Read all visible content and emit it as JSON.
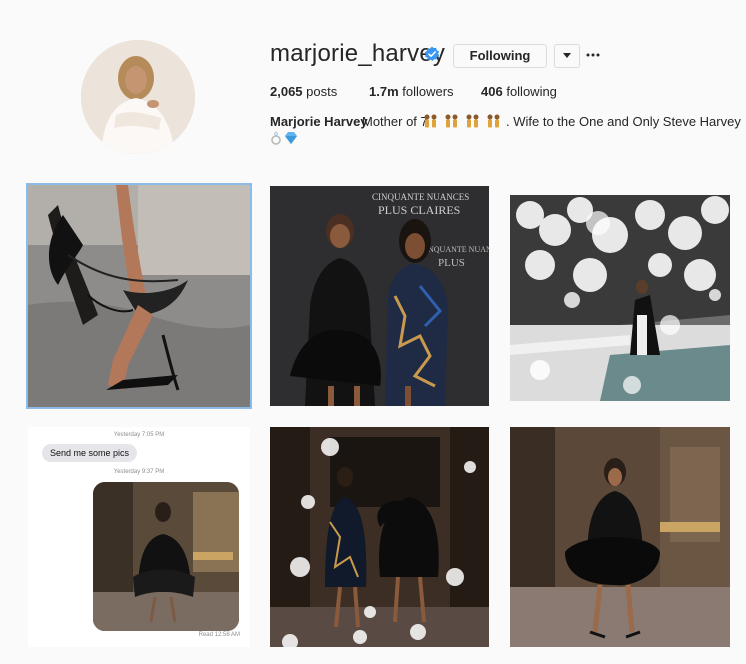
{
  "profile": {
    "username": "marjorie_harvey",
    "follow_label": "Following",
    "stats": {
      "posts_count": "2,065",
      "posts_label": "posts",
      "followers_count": "1.7m",
      "followers_label": "followers",
      "following_count": "406",
      "following_label": "following"
    },
    "bio": {
      "name": "Marjorie Harvey",
      "text_a": "Mother of 7",
      "text_b": ". Wife to the One and Only Steve Harvey"
    }
  },
  "posts": {
    "tile4": {
      "ts1": "Yesterday 7:05 PM",
      "message": "Send me some pics",
      "ts2": "Yesterday 9:37 PM",
      "read": "Read 12:58 AM"
    },
    "tile2": {
      "brand_a": "CINQUANTE NUANCES",
      "brand_b": "PLUS CLAIRES",
      "brand_c": "CINQUANTE NUANCES",
      "brand_d": "PLUS"
    }
  },
  "icons": [
    "verified-badge-icon",
    "chevron-down-icon",
    "more-options-icon",
    "people-emoji-icon",
    "ring-emoji-icon",
    "gem-emoji-icon"
  ],
  "colors": {
    "verified": "#3897f0",
    "selected_outline": "#8bbbe8"
  }
}
